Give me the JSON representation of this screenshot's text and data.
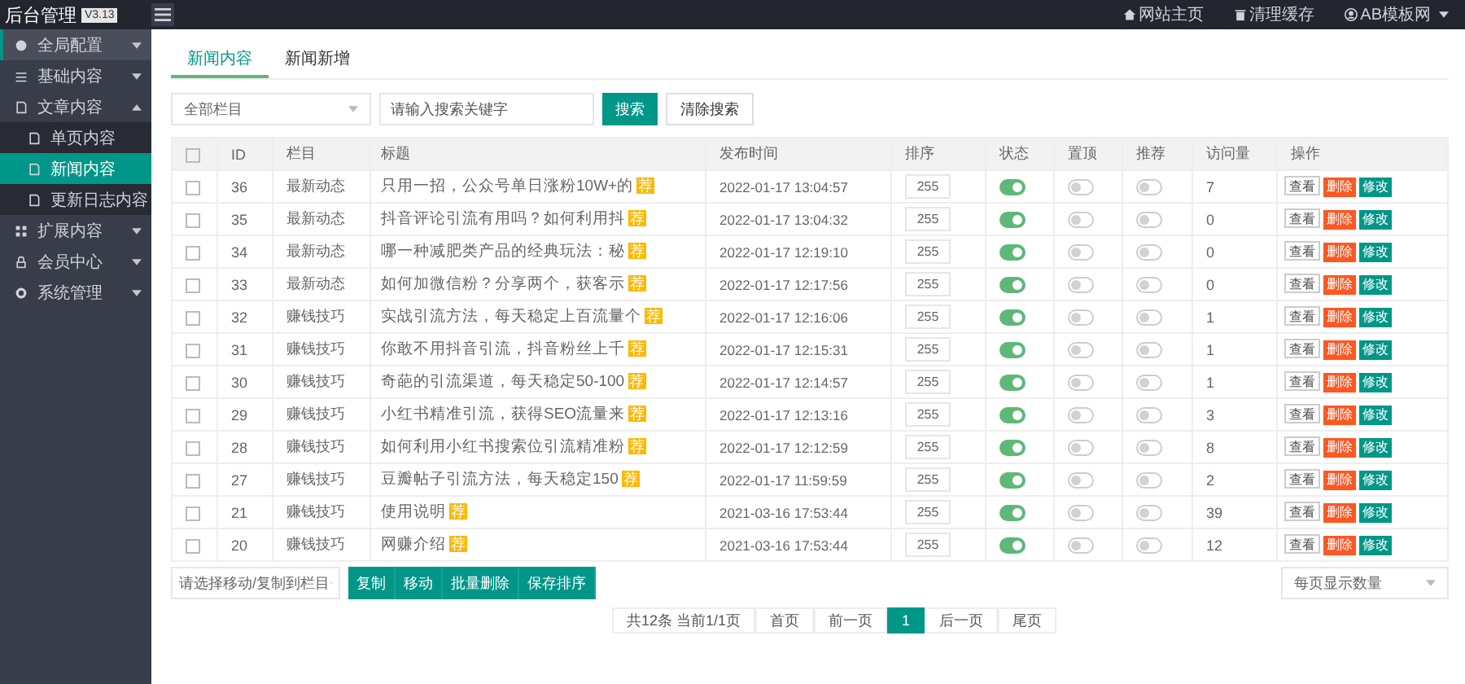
{
  "header": {
    "logo": "后台管理",
    "version": "V3.13",
    "links": [
      {
        "label": "网站主页",
        "kind": "home"
      },
      {
        "label": "清理缓存",
        "kind": "trash"
      },
      {
        "label": "AB模板网",
        "kind": "user"
      }
    ]
  },
  "sidebar": {
    "items": [
      {
        "label": "全局配置",
        "selected": true,
        "expanded": false
      },
      {
        "label": "基础内容",
        "selected": false,
        "expanded": false
      },
      {
        "label": "文章内容",
        "selected": false,
        "expanded": true,
        "children": [
          {
            "label": "单页内容",
            "selected": false
          },
          {
            "label": "新闻内容",
            "selected": true
          },
          {
            "label": "更新日志内容",
            "selected": false
          }
        ]
      },
      {
        "label": "扩展内容",
        "selected": false,
        "expanded": false
      },
      {
        "label": "会员中心",
        "selected": false,
        "expanded": false
      },
      {
        "label": "系统管理",
        "selected": false,
        "expanded": false
      }
    ]
  },
  "tabs": [
    {
      "label": "新闻内容",
      "selected": true
    },
    {
      "label": "新闻新增",
      "selected": false
    }
  ],
  "filter": {
    "category": "全部栏目",
    "search_placeholder": "请输入搜索关键字",
    "search_button": "搜索",
    "clear_button": "清除搜索"
  },
  "table": {
    "select_all_checked": false,
    "columns": [
      "ID",
      "栏目",
      "标题",
      "发布时间",
      "排序",
      "状态",
      "置顶",
      "推荐",
      "访问量",
      "操作"
    ],
    "rows": [
      {
        "checked": false,
        "id": "36",
        "category": "最新动态",
        "title": "只用一招，公众号单日涨粉10W+的",
        "badge": "荐",
        "time": "2022-01-17 13:04:57",
        "sort": "255",
        "status": true,
        "top": false,
        "recommend": false,
        "visits": "7",
        "actions": [
          "查看",
          "删除",
          "修改"
        ]
      },
      {
        "checked": false,
        "id": "35",
        "category": "最新动态",
        "title": "抖音评论引流有用吗？如何利用抖",
        "badge": "荐",
        "time": "2022-01-17 13:04:32",
        "sort": "255",
        "status": true,
        "top": false,
        "recommend": false,
        "visits": "0",
        "actions": [
          "查看",
          "删除",
          "修改"
        ]
      },
      {
        "checked": false,
        "id": "34",
        "category": "最新动态",
        "title": "哪一种减肥类产品的经典玩法：秘",
        "badge": "荐",
        "time": "2022-01-17 12:19:10",
        "sort": "255",
        "status": true,
        "top": false,
        "recommend": false,
        "visits": "0",
        "actions": [
          "查看",
          "删除",
          "修改"
        ]
      },
      {
        "checked": false,
        "id": "33",
        "category": "最新动态",
        "title": "如何加微信粉？分享两个，获客示",
        "badge": "荐",
        "time": "2022-01-17 12:17:56",
        "sort": "255",
        "status": true,
        "top": false,
        "recommend": false,
        "visits": "0",
        "actions": [
          "查看",
          "删除",
          "修改"
        ]
      },
      {
        "checked": false,
        "id": "32",
        "category": "赚钱技巧",
        "title": "实战引流方法，每天稳定上百流量个",
        "badge": "荐",
        "time": "2022-01-17 12:16:06",
        "sort": "255",
        "status": true,
        "top": false,
        "recommend": false,
        "visits": "1",
        "actions": [
          "查看",
          "删除",
          "修改"
        ]
      },
      {
        "checked": false,
        "id": "31",
        "category": "赚钱技巧",
        "title": "你敢不用抖音引流，抖音粉丝上千",
        "badge": "荐",
        "time": "2022-01-17 12:15:31",
        "sort": "255",
        "status": true,
        "top": false,
        "recommend": false,
        "visits": "1",
        "actions": [
          "查看",
          "删除",
          "修改"
        ]
      },
      {
        "checked": false,
        "id": "30",
        "category": "赚钱技巧",
        "title": "奇葩的引流渠道，每天稳定50-100",
        "badge": "荐",
        "time": "2022-01-17 12:14:57",
        "sort": "255",
        "status": true,
        "top": false,
        "recommend": false,
        "visits": "1",
        "actions": [
          "查看",
          "删除",
          "修改"
        ]
      },
      {
        "checked": false,
        "id": "29",
        "category": "赚钱技巧",
        "title": "小红书精准引流，获得SEO流量来",
        "badge": "荐",
        "time": "2022-01-17 12:13:16",
        "sort": "255",
        "status": true,
        "top": false,
        "recommend": false,
        "visits": "3",
        "actions": [
          "查看",
          "删除",
          "修改"
        ]
      },
      {
        "checked": false,
        "id": "28",
        "category": "赚钱技巧",
        "title": "如何利用小红书搜索位引流精准粉",
        "badge": "荐",
        "time": "2022-01-17 12:12:59",
        "sort": "255",
        "status": true,
        "top": false,
        "recommend": false,
        "visits": "8",
        "actions": [
          "查看",
          "删除",
          "修改"
        ]
      },
      {
        "checked": false,
        "id": "27",
        "category": "赚钱技巧",
        "title": "豆瓣帖子引流方法，每天稳定150",
        "badge": "荐",
        "time": "2022-01-17 11:59:59",
        "sort": "255",
        "status": true,
        "top": false,
        "recommend": false,
        "visits": "2",
        "actions": [
          "查看",
          "删除",
          "修改"
        ]
      },
      {
        "checked": false,
        "id": "21",
        "category": "赚钱技巧",
        "title": "使用说明",
        "badge": "荐",
        "time": "2021-03-16 17:53:44",
        "sort": "255",
        "status": true,
        "top": false,
        "recommend": false,
        "visits": "39",
        "actions": [
          "查看",
          "删除",
          "修改"
        ]
      },
      {
        "checked": false,
        "id": "20",
        "category": "赚钱技巧",
        "title": "网赚介绍",
        "badge": "荐",
        "time": "2021-03-16 17:53:44",
        "sort": "255",
        "status": true,
        "top": false,
        "recommend": false,
        "visits": "12",
        "actions": [
          "查看",
          "删除",
          "修改"
        ]
      }
    ]
  },
  "batch": {
    "target_placeholder": "请选择移动/复制到栏目",
    "buttons": [
      "复制",
      "移动",
      "批量删除",
      "保存排序"
    ],
    "page_size_placeholder": "每页显示数量"
  },
  "pagination": {
    "summary": "共12条 当前1/1页",
    "pages": [
      {
        "label": "首页",
        "selected": false
      },
      {
        "label": "前一页",
        "selected": false
      },
      {
        "label": "1",
        "selected": true
      },
      {
        "label": "后一页",
        "selected": false
      },
      {
        "label": "尾页",
        "selected": false
      }
    ]
  }
}
